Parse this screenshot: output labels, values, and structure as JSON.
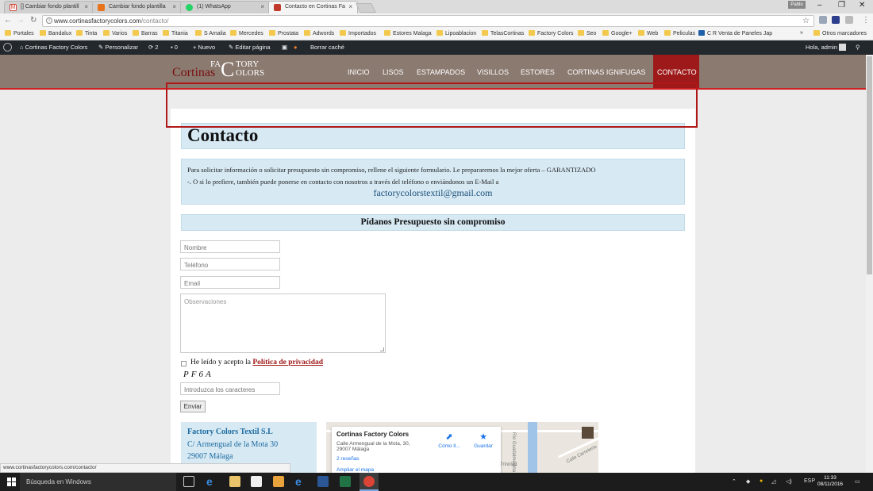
{
  "browser": {
    "tabs": [
      {
        "title": "[] Cambiar fondo plantill",
        "icon": "gmail-icon",
        "color": "#d44638"
      },
      {
        "title": "Cambiar fondo plantilla",
        "icon": "site-icon",
        "color": "#e8731b"
      },
      {
        "title": "(1) WhatsApp",
        "icon": "whatsapp-icon",
        "color": "#25d366"
      },
      {
        "title": "Contacto en Cortinas Fa",
        "icon": "site-icon",
        "color": "#c0392b"
      }
    ],
    "profile": "Pablo",
    "url_domain": "www.cortinasfactorycolors.com",
    "url_path": "/contacto/",
    "bookmarks": [
      "Portales",
      "Bandalux",
      "Tinta",
      "Varios",
      "Barras",
      "Titania",
      "S Amalia",
      "Mercedes",
      "Prostata",
      "Adwords",
      "Importados",
      "Estores Malaga",
      "Lipoablacion",
      "TelasCortinas",
      "Factory Colors",
      "Seo",
      "Google+",
      "Web",
      "Peliculas",
      "C R  Venta de Paneles Jap"
    ],
    "bookmarks_overflow": "»",
    "other_bookmarks": "Otros marcadores",
    "status_url": "www.cortinasfactorycolors.com/contacto/"
  },
  "wp_admin": {
    "site": "Cortinas Factory Colors",
    "customize": "Personalizar",
    "updates": "2",
    "comments": "0",
    "new": "Nuevo",
    "edit": "Editar página",
    "clear_cache": "Borrar caché",
    "greeting": "Hola, admin"
  },
  "site": {
    "logo_cortinas": "Cortinas",
    "logo_fa": "FA",
    "logo_c": "C",
    "logo_tory": "TORY",
    "logo_olors": "OLORS",
    "menu": [
      "INICIO",
      "LISOS",
      "ESTAMPADOS",
      "VISILLOS",
      "ESTORES",
      "CORTINAS IGNIFUGAS",
      "CONTACTO"
    ],
    "active_menu": "CONTACTO",
    "accent": "#9e1a1a"
  },
  "page": {
    "title": "Contacto",
    "intro_line1": "Para solicitar información o solicitar presupuesto sin compromiso, rellene el siguiente formulario. Le prepararemos la mejor oferta – GARANTIZADO",
    "intro_line2": "-. O si lo prefiere, también puede ponerse en contacto con nosotros a través del teléfono o enviándonos un E-Mail a",
    "email": "factorycolorstextil@gmail.com",
    "form_title": "Pídanos Presupuesto sin compromiso",
    "form": {
      "name_placeholder": "Nombre",
      "phone_placeholder": "Teléfono",
      "email_placeholder": "Email",
      "notes_placeholder": "Observaciones",
      "privacy_text": "He leído y acepto la",
      "privacy_link": "Política de privacidad",
      "captcha": "PF6A",
      "captcha_placeholder": "Introduzca los caracteres",
      "submit": "Enviar"
    },
    "company": {
      "name": "Factory Colors Textil S.L",
      "street": "C/ Armengual de la Mota 30",
      "city": "29007 Málaga"
    },
    "map": {
      "place": "Cortinas Factory Colors",
      "addr1": "Calle Armengual de la Mota, 30,",
      "addr2": "29007 Málaga",
      "reviews": "2 reseñas",
      "enlarge": "Ampliar el mapa",
      "directions": "Cómo ll...",
      "save": "Guardar",
      "street_label": "Calle Carreteria",
      "area_label": "Trinidad",
      "river_label": "Río Guadalmedina"
    }
  },
  "taskbar": {
    "search": "Búsqueda en Windows",
    "lang": "ESP",
    "time": "11:33",
    "date": "08/11/2016"
  }
}
